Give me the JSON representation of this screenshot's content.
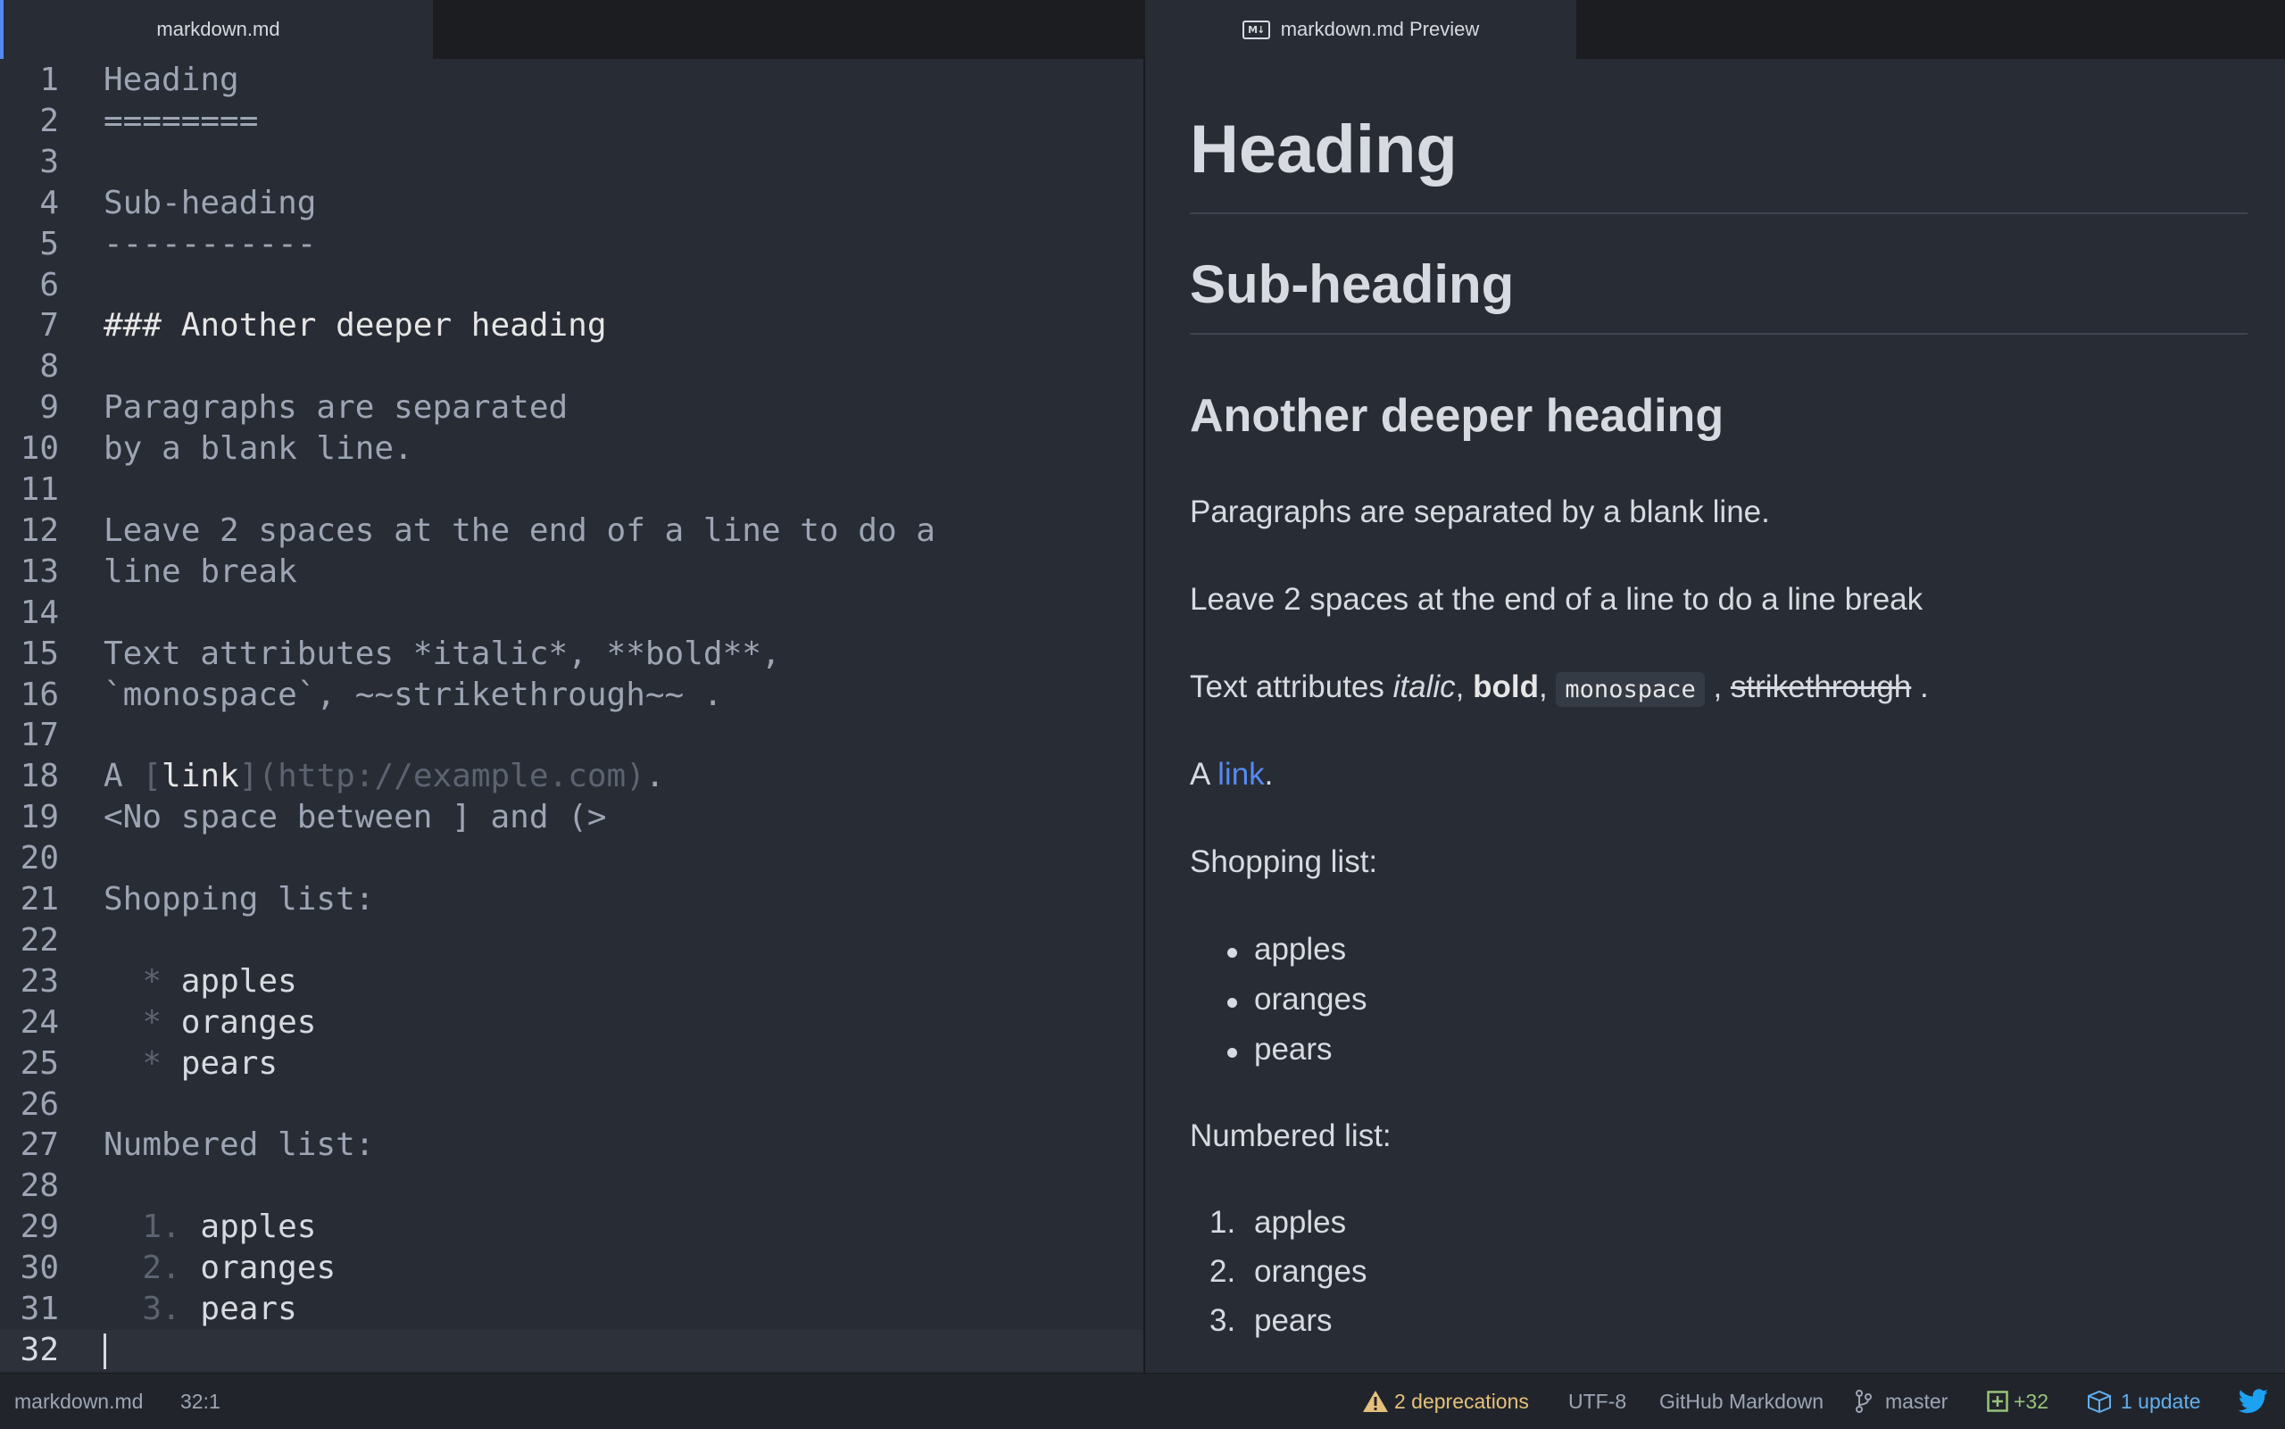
{
  "tabs": {
    "editor_title": "markdown.md",
    "preview_title": "markdown.md Preview",
    "preview_icon": "markdown-icon",
    "preview_icon_text": "M↓"
  },
  "editor": {
    "lines": [
      {
        "n": "1",
        "t": "Heading"
      },
      {
        "n": "2",
        "t": "========"
      },
      {
        "n": "3",
        "t": ""
      },
      {
        "n": "4",
        "t": "Sub-heading"
      },
      {
        "n": "5",
        "t": "-----------"
      },
      {
        "n": "6",
        "t": ""
      },
      {
        "n": "7",
        "t": "### Another deeper heading"
      },
      {
        "n": "8",
        "t": ""
      },
      {
        "n": "9",
        "t": "Paragraphs are separated"
      },
      {
        "n": "10",
        "t": "by a blank line."
      },
      {
        "n": "11",
        "t": ""
      },
      {
        "n": "12",
        "t": "Leave 2 spaces at the end of a line to do a"
      },
      {
        "n": "13",
        "t": "line break"
      },
      {
        "n": "14",
        "t": ""
      },
      {
        "n": "15",
        "t": "Text attributes *italic*, **bold**,"
      },
      {
        "n": "16",
        "t": "`monospace`, ~~strikethrough~~ ."
      },
      {
        "n": "17",
        "t": ""
      },
      {
        "n": "18",
        "t": "A [link](http://example.com)."
      },
      {
        "n": "19",
        "t": "<No space between ] and (>"
      },
      {
        "n": "20",
        "t": ""
      },
      {
        "n": "21",
        "t": "Shopping list:"
      },
      {
        "n": "22",
        "t": ""
      },
      {
        "n": "23",
        "t": "  * apples"
      },
      {
        "n": "24",
        "t": "  * oranges"
      },
      {
        "n": "25",
        "t": "  * pears"
      },
      {
        "n": "26",
        "t": ""
      },
      {
        "n": "27",
        "t": "Numbered list:"
      },
      {
        "n": "28",
        "t": ""
      },
      {
        "n": "29",
        "t": "  1. apples"
      },
      {
        "n": "30",
        "t": "  2. oranges"
      },
      {
        "n": "31",
        "t": "  3. pears"
      },
      {
        "n": "32",
        "t": ""
      }
    ],
    "link_prefix": "A ",
    "link_open": "[",
    "link_text": "link",
    "link_url": "](http://example.com)",
    "link_end": ".",
    "heading3": "### Another deeper heading"
  },
  "preview": {
    "h1": "Heading",
    "h2": "Sub-heading",
    "h3": "Another deeper heading",
    "p1": "Paragraphs are separated by a blank line.",
    "p2": "Leave 2 spaces at the end of a line to do a line break",
    "p3_prefix": "Text attributes ",
    "p3_italic": "italic",
    "p3_sep1": ", ",
    "p3_bold": "bold",
    "p3_sep2": ", ",
    "p3_mono": "monospace",
    "p3_sep3": " , ",
    "p3_strike": "strikethrough",
    "p3_end": " .",
    "p4_prefix": "A ",
    "p4_link": "link",
    "p4_end": ".",
    "shopping_label": "Shopping list:",
    "shopping": [
      "apples",
      "oranges",
      "pears"
    ],
    "numbered_label": "Numbered list:",
    "numbered": [
      {
        "num": "1.",
        "text": "apples"
      },
      {
        "num": "2.",
        "text": "oranges"
      },
      {
        "num": "3.",
        "text": "pears"
      }
    ]
  },
  "status": {
    "file": "markdown.md",
    "cursor": "32:1",
    "deprecations": "2 deprecations",
    "encoding": "UTF-8",
    "grammar": "GitHub Markdown",
    "branch": "master",
    "diff": "+32",
    "updates": "1 update"
  },
  "colors": {
    "accent": "#568af2",
    "background": "#282c34",
    "warning": "#e5c07b",
    "added": "#98c379",
    "twitter": "#1da1f2"
  }
}
